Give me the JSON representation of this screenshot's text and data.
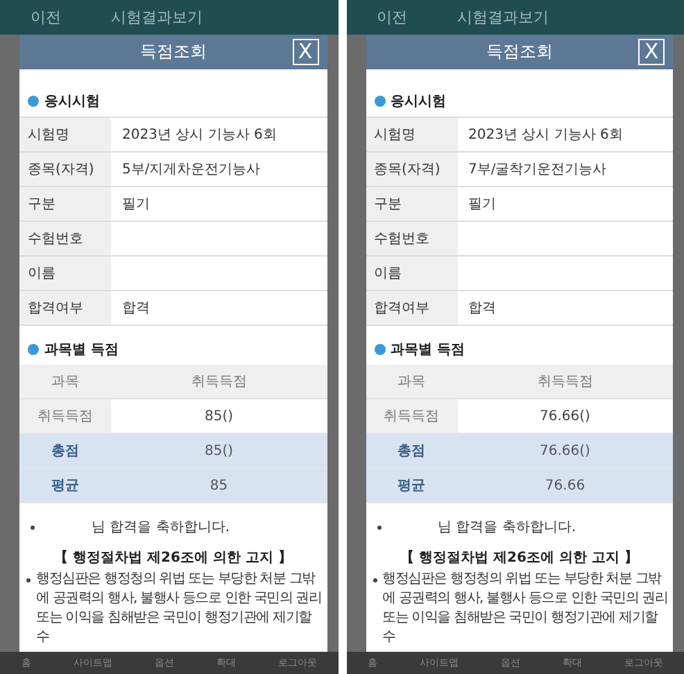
{
  "panels": [
    {
      "topbar": {
        "back": "이전",
        "title": "시험결과보기"
      },
      "modal": {
        "title": "득점조회",
        "close": "X",
        "exam_section": {
          "title": "응시시험",
          "rows": [
            {
              "label": "시험명",
              "value": "2023년 상시 기능사 6회"
            },
            {
              "label": "종목(자격)",
              "value": "5부/지게차운전기능사"
            },
            {
              "label": "구분",
              "value": "필기"
            },
            {
              "label": "수험번호"
            },
            {
              "label": "이름"
            },
            {
              "label": "합격여부",
              "value": "합격"
            }
          ]
        },
        "score_section": {
          "title": "과목별 득점",
          "columns": [
            "과목",
            "취득득점"
          ],
          "rows": [
            {
              "kind": "plain",
              "label": "취득득점",
              "value": "85()"
            },
            {
              "kind": "summary",
              "label": "총점",
              "value": "85()"
            },
            {
              "kind": "summary",
              "label": "평균",
              "value": "85"
            }
          ]
        },
        "congrats": "님 합격을 축하합니다.",
        "notice_title": "【 행정절차법 제26조에 의한 고지 】",
        "notice_text": "행정심판은 행정청의 위법 또는 부당한 처분 그밖에 공권력의 행사, 불행사 등으로 인한 국민의 권리 또는 이익을 침해받은 국민이 행정기관에 제기할 수"
      },
      "nav": [
        "홈",
        "사이트맵",
        "옵션",
        "확대",
        "로그아웃"
      ]
    },
    {
      "topbar": {
        "back": "이전",
        "title": "시험결과보기"
      },
      "modal": {
        "title": "득점조회",
        "close": "X",
        "exam_section": {
          "title": "응시시험",
          "rows": [
            {
              "label": "시험명",
              "value": "2023년 상시 기능사 6회"
            },
            {
              "label": "종목(자격)",
              "value": "7부/굴착기운전기능사"
            },
            {
              "label": "구분",
              "value": "필기"
            },
            {
              "label": "수험번호"
            },
            {
              "label": "이름"
            },
            {
              "label": "합격여부",
              "value": "합격"
            }
          ]
        },
        "score_section": {
          "title": "과목별 득점",
          "columns": [
            "과목",
            "취득득점"
          ],
          "rows": [
            {
              "kind": "plain",
              "label": "취득득점",
              "value": "76.66()"
            },
            {
              "kind": "summary",
              "label": "총점",
              "value": "76.66()"
            },
            {
              "kind": "summary",
              "label": "평균",
              "value": "76.66"
            }
          ]
        },
        "congrats": "님 합격을 축하합니다.",
        "notice_title": "【 행정절차법 제26조에 의한 고지 】",
        "notice_text": "행정심판은 행정청의 위법 또는 부당한 처분 그밖에 공권력의 행사, 불행사 등으로 인한 국민의 권리 또는 이익을 침해받은 국민이 행정기관에 제기할 수"
      },
      "nav": [
        "홈",
        "사이트맵",
        "옵션",
        "확대",
        "로그아웃"
      ]
    }
  ]
}
